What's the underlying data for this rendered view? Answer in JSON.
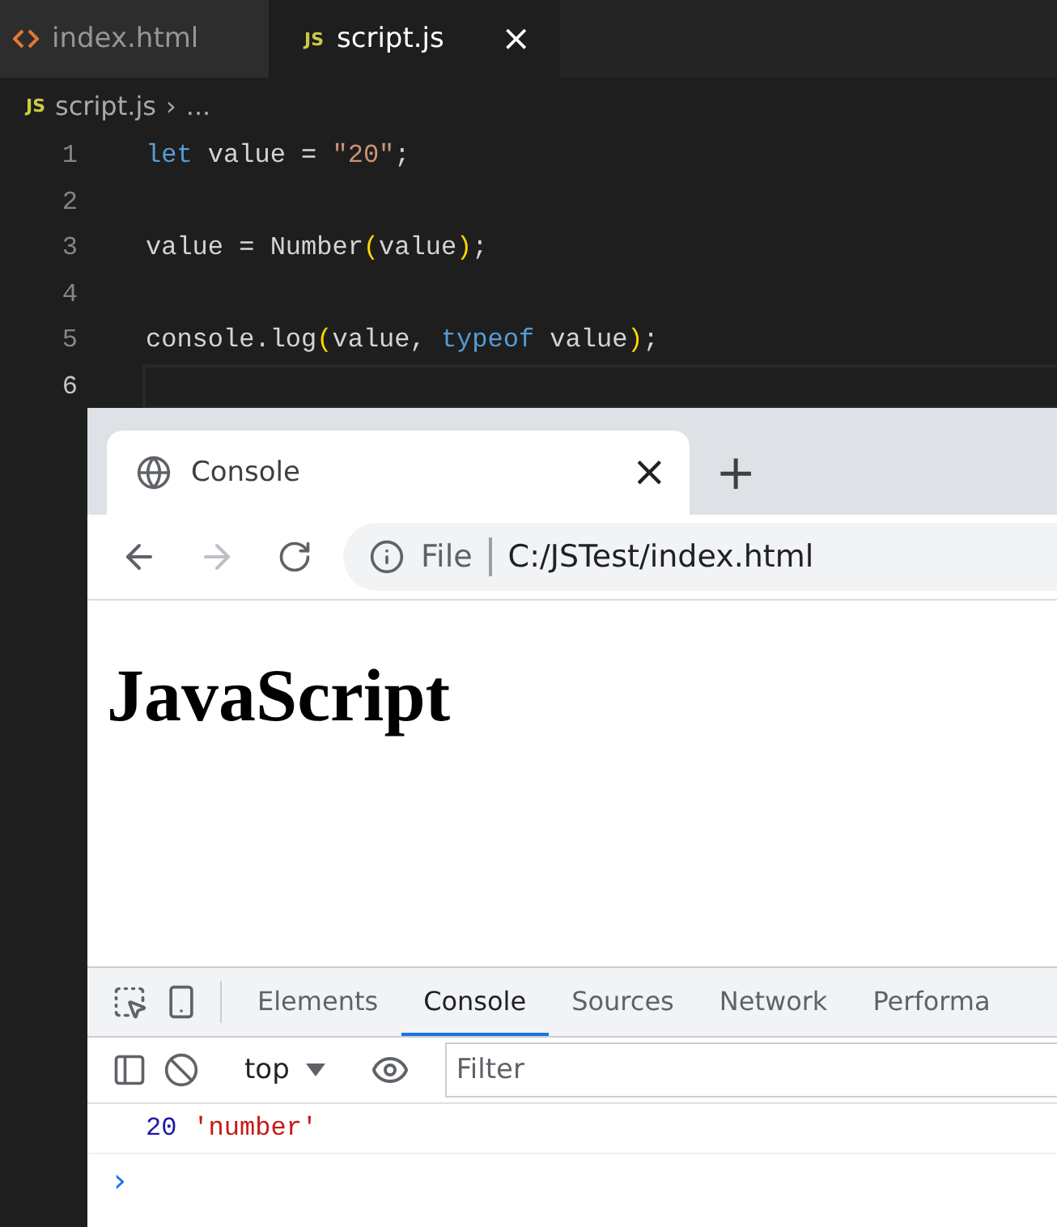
{
  "editor": {
    "tabs": [
      {
        "label": "index.html",
        "kind": "html",
        "selected": false
      },
      {
        "label": "script.js",
        "kind": "js",
        "icon": "JS",
        "selected": true,
        "close": "×"
      }
    ],
    "breadcrumb": {
      "icon": "JS",
      "file": "script.js",
      "separator": "›",
      "rest": "..."
    },
    "lines": [
      {
        "number": "1",
        "active": false,
        "tokens": [
          {
            "text": "let",
            "kind": "keyword"
          },
          {
            "text": " value = ",
            "kind": "plain"
          },
          {
            "text": "\"20\"",
            "kind": "string"
          },
          {
            "text": ";",
            "kind": "plain"
          }
        ]
      },
      {
        "number": "2",
        "active": false
      },
      {
        "number": "3",
        "active": false,
        "tokens": [
          {
            "text": "value = Number",
            "kind": "plain"
          },
          {
            "text": "(",
            "kind": "bracket"
          },
          {
            "text": "value",
            "kind": "plain"
          },
          {
            "text": ")",
            "kind": "bracket"
          },
          {
            "text": ";",
            "kind": "plain"
          }
        ]
      },
      {
        "number": "4",
        "active": false
      },
      {
        "number": "5",
        "active": false,
        "tokens": [
          {
            "text": "console.log",
            "kind": "plain"
          },
          {
            "text": "(",
            "kind": "bracket"
          },
          {
            "text": "value, ",
            "kind": "plain"
          },
          {
            "text": "typeof",
            "kind": "keyword"
          },
          {
            "text": " value",
            "kind": "plain"
          },
          {
            "text": ")",
            "kind": "bracket"
          },
          {
            "text": ";",
            "kind": "plain"
          }
        ]
      },
      {
        "number": "6",
        "active": true
      }
    ]
  },
  "browser": {
    "tab": {
      "title": "Console",
      "close": "×",
      "new_tab": "+"
    },
    "address": {
      "scheme": "File",
      "url": "C:/JSTest/index.html"
    },
    "forward_disabled": true,
    "page": {
      "heading": "JavaScript"
    },
    "devtools": {
      "tabs": [
        {
          "label": "Elements",
          "selected": false
        },
        {
          "label": "Console",
          "selected": true
        },
        {
          "label": "Sources",
          "selected": false
        },
        {
          "label": "Network",
          "selected": false
        },
        {
          "label": "Performa",
          "selected": false
        }
      ],
      "context": "top",
      "filter": {
        "placeholder": "Filter"
      },
      "messages": [
        {
          "tokens": [
            {
              "text": "20",
              "kind": "number"
            },
            {
              "text": "'number'",
              "kind": "string"
            }
          ]
        }
      ],
      "prompt": "›"
    }
  }
}
